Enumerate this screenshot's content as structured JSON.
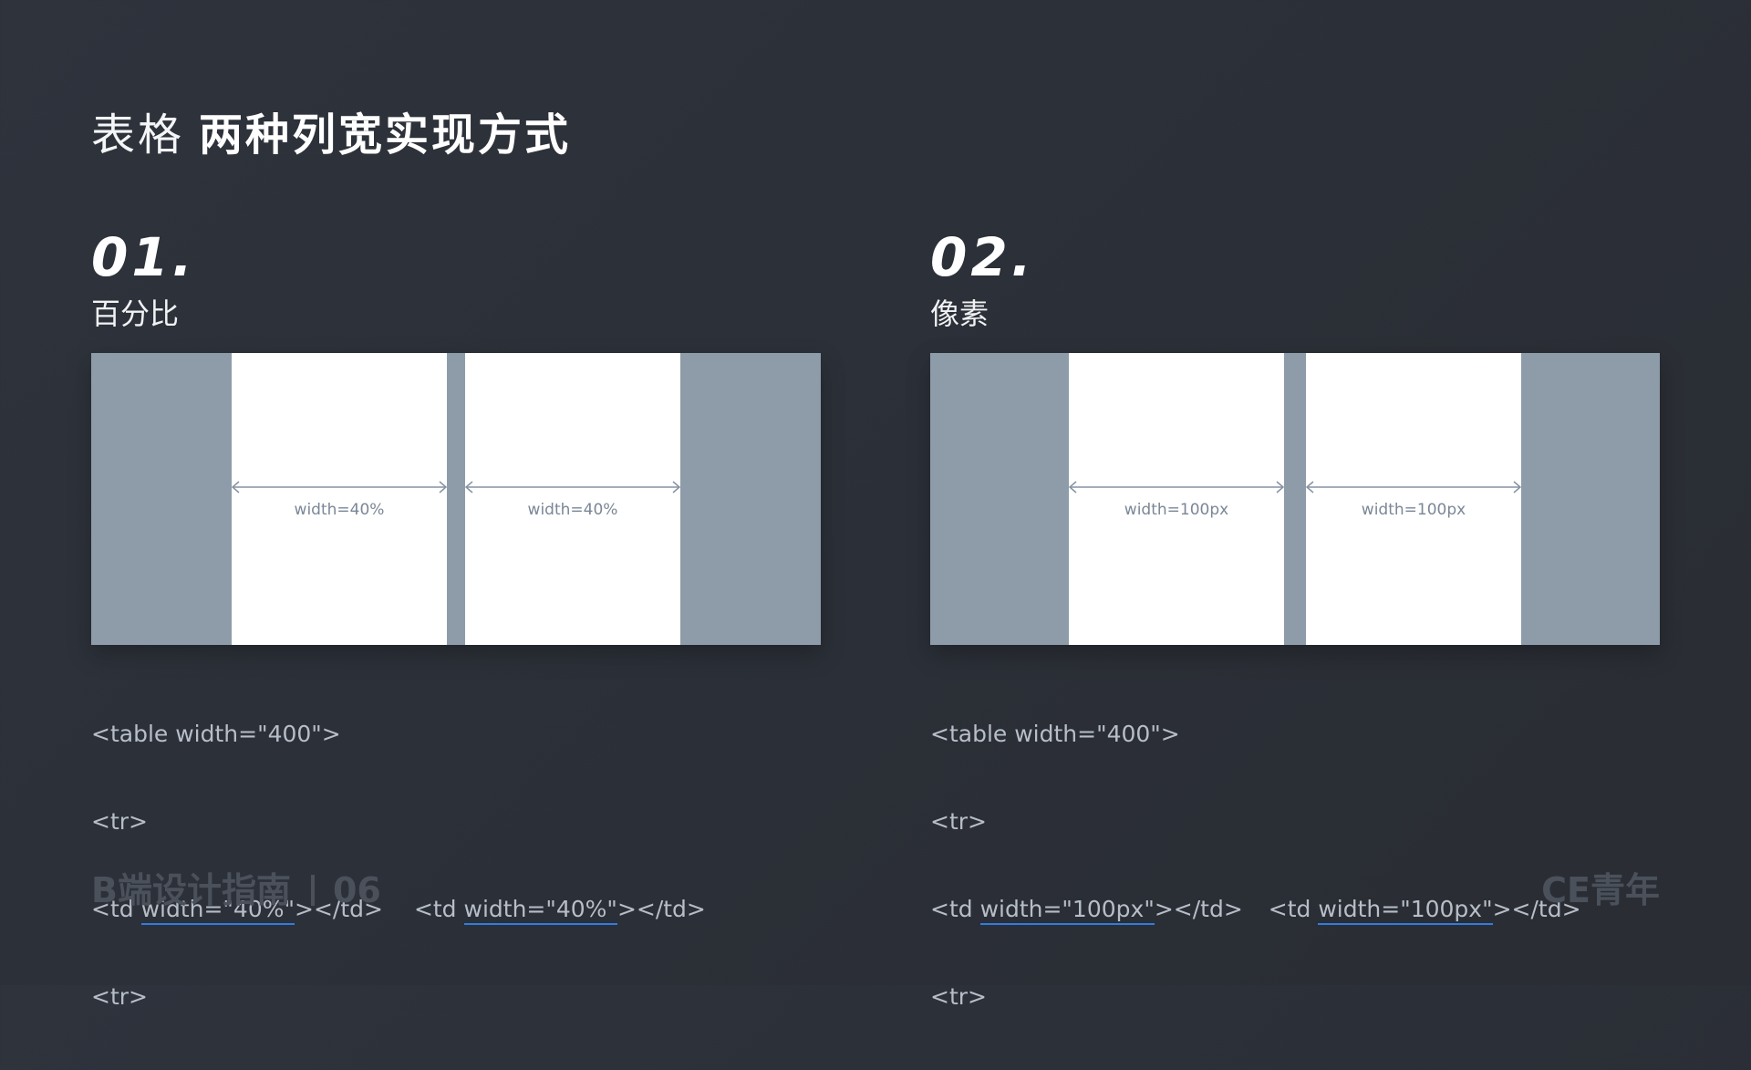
{
  "header": {
    "title_light": "表格",
    "title_bold": "两种列宽实现方式"
  },
  "sections": [
    {
      "number": "01.",
      "subtitle": "百分比",
      "cells": [
        {
          "label": "width=40%"
        },
        {
          "label": "width=40%"
        }
      ],
      "code": {
        "line1": "<table width=\"400\">",
        "line2": "<tr>",
        "td_open_1": "<td ",
        "td_attr_1": "width=\"40%\"",
        "td_close_1": "></td>",
        "td_open_2": "<td ",
        "td_attr_2": "width=\"40%\"",
        "td_close_2": "></td>",
        "line4": "<tr>"
      }
    },
    {
      "number": "02.",
      "subtitle": "像素",
      "cells": [
        {
          "label": "width=100px"
        },
        {
          "label": "width=100px"
        }
      ],
      "code": {
        "line1": "<table width=\"400\">",
        "line2": "<tr>",
        "td_open_1": "<td ",
        "td_attr_1": "width=\"100px\"",
        "td_close_1": "></td>",
        "td_open_2": "<td ",
        "td_attr_2": "width=\"100px\"",
        "td_close_2": "></td>",
        "line4": "<tr>"
      }
    }
  ],
  "footer": {
    "guide": "B端设计指南",
    "page": "06",
    "brand": "CE青年"
  },
  "colors": {
    "background": "#2c3038",
    "table_bg": "#8e9ca9",
    "cell": "#ffffff",
    "underline": "#2f7de3",
    "footer_text": "#4b515b"
  }
}
